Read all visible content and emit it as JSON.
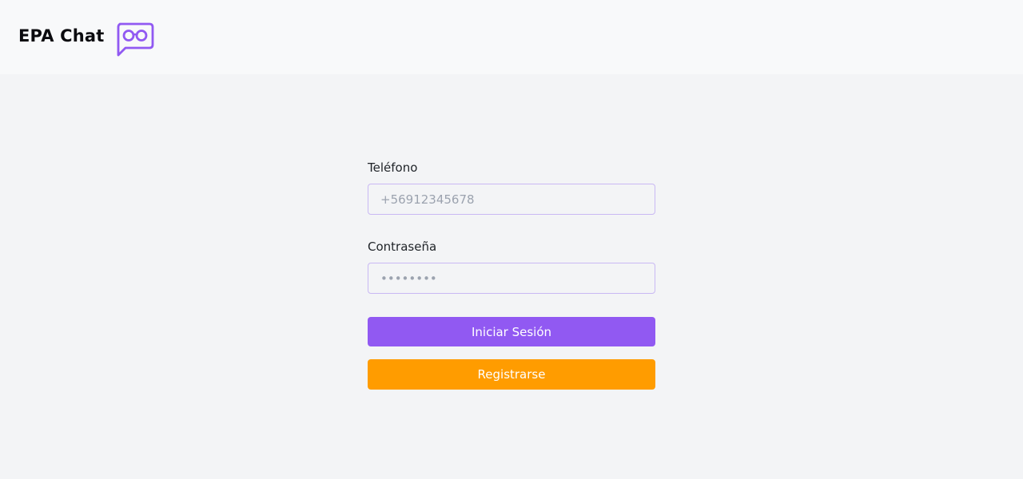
{
  "header": {
    "title": "EPA Chat",
    "logo_icon": "chat-bubble-glasses-icon",
    "background": "#f8f9fa"
  },
  "form": {
    "phone": {
      "label": "Teléfono",
      "placeholder": "+56912345678",
      "value": ""
    },
    "password": {
      "label": "Contraseña",
      "placeholder": "••••••••",
      "value": ""
    },
    "login_button": {
      "label": "Iniciar Sesión",
      "color": "#9159f2"
    },
    "register_button": {
      "label": "Registrarse",
      "color": "#ff9c00"
    }
  },
  "colors": {
    "accent_purple": "#9159f2",
    "accent_orange": "#ff9c00",
    "page_background": "#f3f4f6",
    "input_border": "#c9b8f3"
  }
}
